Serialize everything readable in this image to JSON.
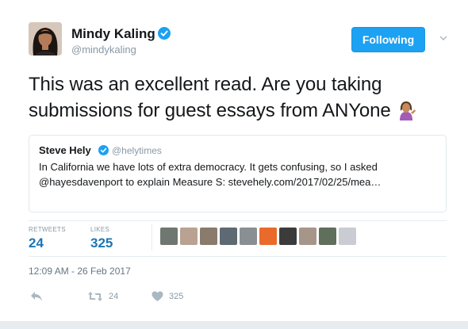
{
  "author": {
    "name": "Mindy Kaling",
    "handle": "@mindykaling",
    "avatar": "avatar",
    "verified_icon": "verified-badge-icon"
  },
  "follow_button": {
    "label": "Following"
  },
  "caret_icon": "chevron-down-icon",
  "tweet": {
    "text": "This was an excellent read. Are you taking submissions for guest essays from ANYone",
    "emoji": "woman-tipping-hand-emoji"
  },
  "quoted_tweet": {
    "name": "Steve Hely",
    "handle": "@helytimes",
    "text": "In California we have lots of extra democracy.  It gets confusing, so I asked @hayesdavenport to explain Measure S: stevehely.com/2017/02/25/mea…"
  },
  "stats": {
    "retweets_label": "RETWEETS",
    "retweets_value": "24",
    "likes_label": "LIKES",
    "likes_value": "325"
  },
  "likers": [
    "#6f7770",
    "#b9a292",
    "#8a7b6d",
    "#5d6a73",
    "#8a8f94",
    "#e96a2a",
    "#3b3b3b",
    "#a6968a",
    "#5f6f5c",
    "#c9cdd3"
  ],
  "timestamp": "12:09 AM - 26 Feb 2017",
  "actions": {
    "reply_icon": "reply-icon",
    "retweet_icon": "retweet-icon",
    "retweet_count": "24",
    "like_icon": "heart-icon",
    "like_count": "325"
  },
  "colors": {
    "accent": "#1da1f2",
    "stat_value": "#1b76b2",
    "muted": "#8899a6"
  }
}
